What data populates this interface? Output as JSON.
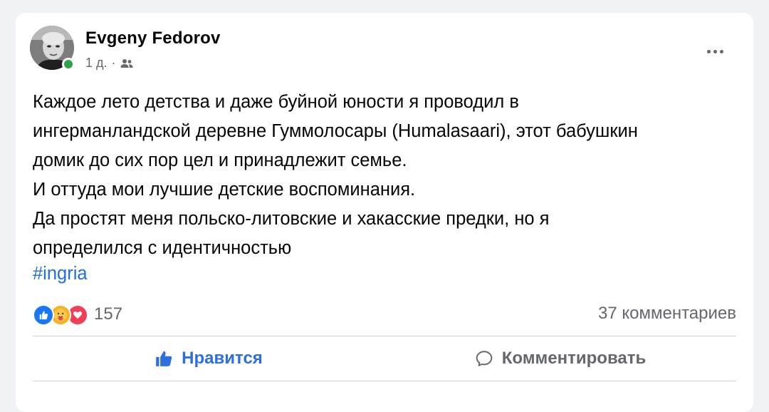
{
  "post": {
    "author": "Evgeny Fedorov",
    "time": "1 д.",
    "separator": "·",
    "privacy_icon": "friends-icon",
    "text_lines": [
      "Каждое лето детства и даже буйной юности я проводил в",
      "ингерманландской деревне Гуммолосары (Humalasaari), этот бабушкин",
      "домик до сих пор цел и принадлежит семье.",
      "И оттуда мои лучшие детские воспоминания.",
      "Да простят меня польско-литовские и хакасские предки, но я",
      "определился с идентичностью"
    ],
    "hashtag": "#ingria"
  },
  "engagement": {
    "reaction_icons": [
      "like-icon",
      "care-icon",
      "love-icon"
    ],
    "reaction_count": "157",
    "comments_count": "37 комментариев"
  },
  "actions": {
    "like_label": "Нравится",
    "comment_label": "Комментировать"
  },
  "colors": {
    "like_blue": "#2d6ee0",
    "hashtag_blue": "#216fdb",
    "online_green": "#31a24c",
    "secondary_text": "#65676b"
  }
}
